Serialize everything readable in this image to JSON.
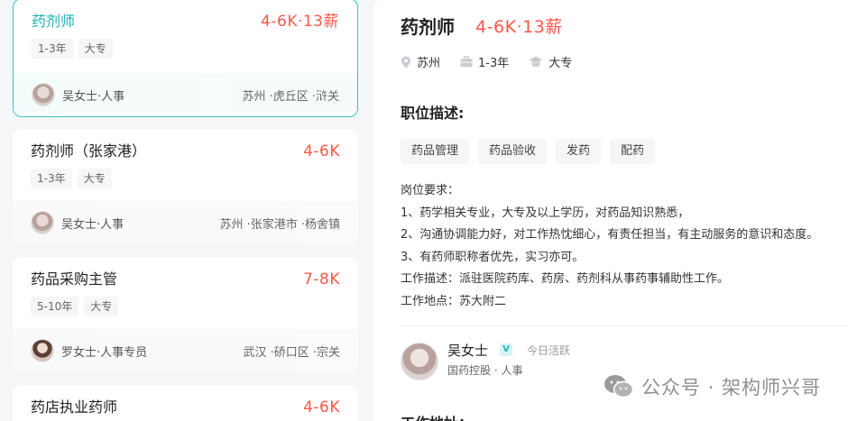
{
  "jobs": [
    {
      "title": "药剂师",
      "salary": "4-6K·13薪",
      "tags": [
        "1-3年",
        "大专"
      ],
      "recruiter": "吴女士·人事",
      "location": "苏州 ·虎丘区 ·浒关",
      "active": true
    },
    {
      "title": "药剂师（张家港）",
      "salary": "4-6K",
      "tags": [
        "1-3年",
        "大专"
      ],
      "recruiter": "吴女士·人事",
      "location": "苏州 ·张家港市 ·杨舍镇",
      "active": false
    },
    {
      "title": "药品采购主管",
      "salary": "7-8K",
      "tags": [
        "5-10年",
        "大专"
      ],
      "recruiter": "罗女士·人事专员",
      "location": "武汉 ·硚口区 ·宗关",
      "active": false
    },
    {
      "title": "药店执业药师",
      "salary": "4-6K",
      "tags": [],
      "recruiter": "",
      "location": "",
      "active": false
    }
  ],
  "detail": {
    "title": "药剂师",
    "salary": "4-6K·13薪",
    "meta": {
      "city": "苏州",
      "experience": "1-3年",
      "education": "大专"
    },
    "section_title": "职位描述:",
    "skills": [
      "药品管理",
      "药品验收",
      "发药",
      "配药"
    ],
    "description": [
      "岗位要求：",
      "1、药学相关专业，大专及以上学历，对药品知识熟悉，",
      "2、沟通协调能力好，对工作热忱细心，有责任担当，有主动服务的意识和态度。",
      "3、有药师职称者优先，实习亦可。",
      "工作描述：派驻医院药库、药房、药剂科从事药事辅助性工作。",
      "工作地点：苏大附二"
    ],
    "boss": {
      "name": "吴女士",
      "verify": "V",
      "active": "今日活跃",
      "company": "国药控股 · 人事"
    },
    "address_title": "工作地址："
  },
  "watermark": "公众号 · 架构师兴哥",
  "colors": {
    "accent": "#38c3c3",
    "salary": "#fe574a"
  },
  "icons": [
    "location-icon",
    "briefcase-icon",
    "graduation-cap-icon",
    "wechat-icon"
  ]
}
